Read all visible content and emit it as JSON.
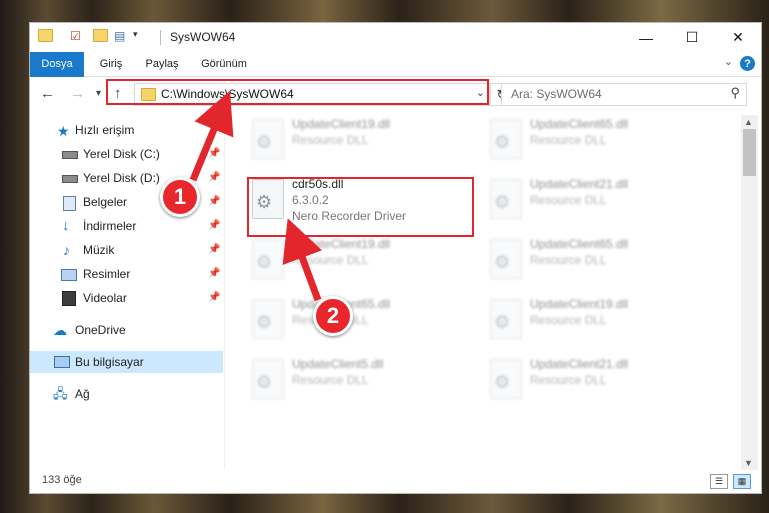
{
  "window": {
    "title": "SysWOW64",
    "controls": {
      "minimize": "—",
      "maximize": "☐",
      "close": "✕"
    }
  },
  "ribbon": {
    "tabs": [
      "Dosya",
      "Giriş",
      "Paylaş",
      "Görünüm"
    ],
    "help": "?"
  },
  "navbar": {
    "address": "C:\\Windows\\SysWOW64",
    "search_placeholder": "Ara: SysWOW64"
  },
  "sidebar": {
    "items": [
      {
        "label": "Hızlı erişim",
        "icon": "star-icon"
      },
      {
        "label": "Yerel Disk (C:)",
        "icon": "drive-icon"
      },
      {
        "label": "Yerel Disk (D:)",
        "icon": "drive-icon"
      },
      {
        "label": "Belgeler",
        "icon": "documents-icon"
      },
      {
        "label": "İndirmeler",
        "icon": "download-icon"
      },
      {
        "label": "Müzik",
        "icon": "music-icon"
      },
      {
        "label": "Resimler",
        "icon": "pictures-icon"
      },
      {
        "label": "Videolar",
        "icon": "video-icon"
      },
      {
        "label": "OneDrive",
        "icon": "cloud-icon"
      },
      {
        "label": "Bu bilgisayar",
        "icon": "computer-icon"
      },
      {
        "label": "Ağ",
        "icon": "network-icon"
      }
    ]
  },
  "files": {
    "highlighted": {
      "name": "cdr50s.dll",
      "version": "6.3.0.2",
      "description": "Nero Recorder Driver"
    },
    "left_column": [
      {
        "name": "UpdateClient19.dll",
        "type": "Resource DLL"
      },
      {
        "name": "UpdateClient19.dll",
        "type": "Resource DLL"
      },
      {
        "name": "UpdateClient65.dll",
        "type": "Resource DLL"
      },
      {
        "name": "UpdateClient5.dll",
        "type": "Resource DLL"
      }
    ],
    "right_column": [
      {
        "name": "UpdateClient65.dll",
        "type": "Resource DLL"
      },
      {
        "name": "UpdateClient21.dll",
        "type": "Resource DLL"
      },
      {
        "name": "UpdateClient65.dll",
        "type": "Resource DLL"
      },
      {
        "name": "UpdateClient19.dll",
        "type": "Resource DLL"
      },
      {
        "name": "UpdateClient21.dll",
        "type": "Resource DLL"
      }
    ]
  },
  "status": {
    "item_count": "133 öğe"
  },
  "annotations": {
    "step1": "1",
    "step2": "2",
    "color": "#e2262c"
  }
}
